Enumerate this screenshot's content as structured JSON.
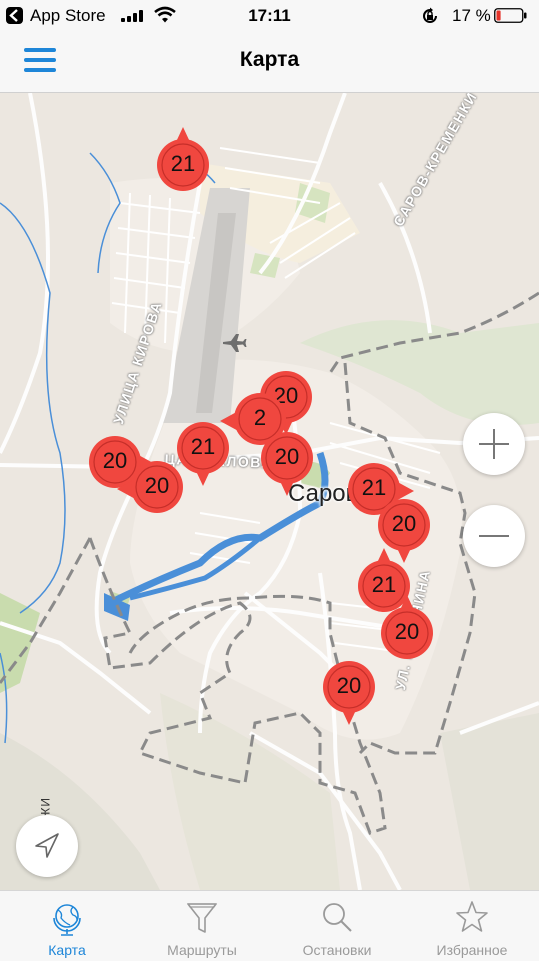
{
  "status_bar": {
    "back_app": "App Store",
    "time": "17:11",
    "battery_percent": "17 %",
    "battery_level": 0.17
  },
  "nav": {
    "title": "Карта",
    "menu_icon": "hamburger-menu-icon"
  },
  "map": {
    "labels": {
      "road_north": "САРОВ-КРЕМЕНКИ",
      "street_kirova": "УЛИЦА КИРОВА",
      "street_mid": "ЦА ЧКАЛОВА",
      "street_south": "УЛ. КАЛИНИНА",
      "city": "Саров",
      "side": "ИЖЕВСКАЯ"
    },
    "markers": [
      {
        "route": "21"
      },
      {
        "route": "20"
      },
      {
        "route": "2"
      },
      {
        "route": "20"
      },
      {
        "route": "21"
      },
      {
        "route": "20"
      },
      {
        "route": "20"
      },
      {
        "route": "21"
      },
      {
        "route": "20"
      },
      {
        "route": "21"
      },
      {
        "route": "20"
      },
      {
        "route": "20"
      }
    ],
    "marker_color": "#f0473f",
    "zoom_in_icon": "plus-icon",
    "zoom_out_icon": "minus-icon",
    "location_icon": "location-arrow-icon"
  },
  "tabs": [
    {
      "label": "Карта",
      "icon": "globe-icon",
      "active": true
    },
    {
      "label": "Маршруты",
      "icon": "funnel-icon",
      "active": false
    },
    {
      "label": "Остановки",
      "icon": "search-icon",
      "active": false
    },
    {
      "label": "Избранное",
      "icon": "star-icon",
      "active": false
    }
  ],
  "colors": {
    "accent": "#1e86d8",
    "inactive": "#9a9a9a",
    "water": "#4a8fd8",
    "park": "#c9dcae"
  }
}
